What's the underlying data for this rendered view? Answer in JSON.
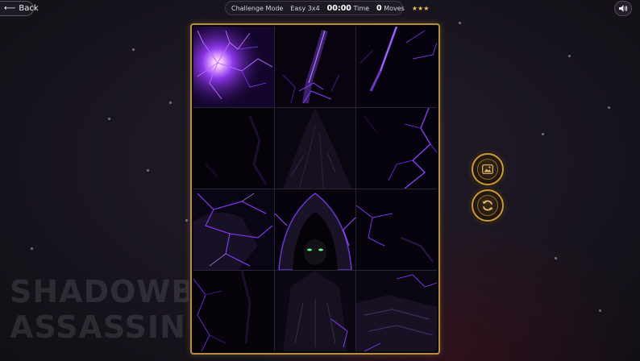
{
  "header": {
    "back_label": "Back",
    "mode": "Challenge Mode",
    "difficulty": "Easy 3x4",
    "time_value": "00:00",
    "time_label": "Time",
    "moves_value": "0",
    "moves_label": "Moves",
    "stars": "★★★",
    "sound_icon": "speaker-icon"
  },
  "title_watermark": {
    "line1": "SHADOWB",
    "line2": "ASSASSIN"
  },
  "side_buttons": {
    "preview_icon": "image-preview-icon",
    "shuffle_icon": "refresh-icon"
  },
  "puzzle": {
    "rows": 4,
    "cols": 3,
    "accent_color": "#8a3cff",
    "frame_color": "#b98f3f"
  }
}
